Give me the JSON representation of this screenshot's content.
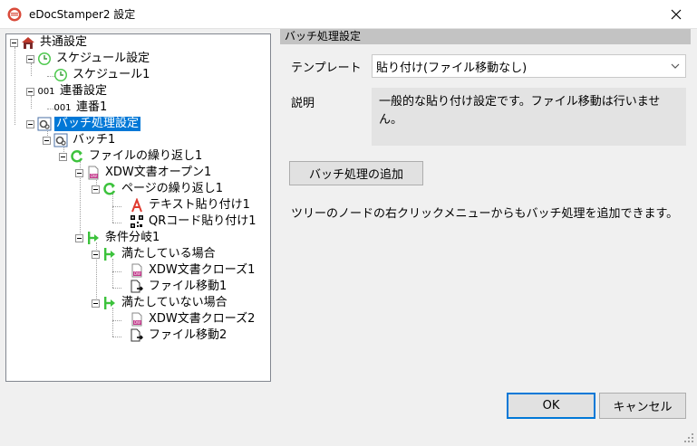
{
  "window": {
    "title": "eDocStamper2 設定",
    "close_icon": "close-icon"
  },
  "tree": [
    {
      "label": "共通設定",
      "icon": "house-icon"
    },
    {
      "label": "スケジュール設定",
      "icon": "clock-icon"
    },
    {
      "label": "スケジュール1",
      "icon": "clock-icon"
    },
    {
      "label": "連番設定",
      "icon": "number-icon",
      "icon_text": "001"
    },
    {
      "label": "連番1",
      "icon": "number-icon",
      "icon_text": "001"
    },
    {
      "label": "バッチ処理設定",
      "icon": "batch-gear-icon"
    },
    {
      "label": "バッチ1",
      "icon": "batch-gear-icon"
    },
    {
      "label": "ファイルの繰り返し1",
      "icon": "loop-icon"
    },
    {
      "label": "XDW文書オープン1",
      "icon": "xdw-document-icon"
    },
    {
      "label": "ページの繰り返し1",
      "icon": "loop-icon"
    },
    {
      "label": "テキスト貼り付け1",
      "icon": "text-a-icon"
    },
    {
      "label": "QRコード貼り付け1",
      "icon": "qr-code-icon"
    },
    {
      "label": "条件分岐1",
      "icon": "branch-arrow-icon"
    },
    {
      "label": "満たしている場合",
      "icon": "branch-arrow-icon"
    },
    {
      "label": "XDW文書クローズ1",
      "icon": "xdw-document-icon"
    },
    {
      "label": "ファイル移動1",
      "icon": "file-move-icon"
    },
    {
      "label": "満たしていない場合",
      "icon": "branch-arrow-icon"
    },
    {
      "label": "XDW文書クローズ2",
      "icon": "xdw-document-icon"
    },
    {
      "label": "ファイル移動2",
      "icon": "file-move-icon"
    }
  ],
  "panel": {
    "header": "バッチ処理設定",
    "template_label": "テンプレート",
    "template_value": "貼り付け(ファイル移動なし)",
    "description_label": "説明",
    "description_text": "一般的な貼り付け設定です。ファイル移動は行いません。",
    "add_button": "バッチ処理の追加",
    "hint": "ツリーのノードの右クリックメニューからもバッチ処理を追加できます。"
  },
  "footer": {
    "ok": "OK",
    "cancel": "キャンセル"
  },
  "colors": {
    "selection": "#0078d7",
    "accent_green": "#3cc23c",
    "header_bg": "#c3c3c3"
  }
}
